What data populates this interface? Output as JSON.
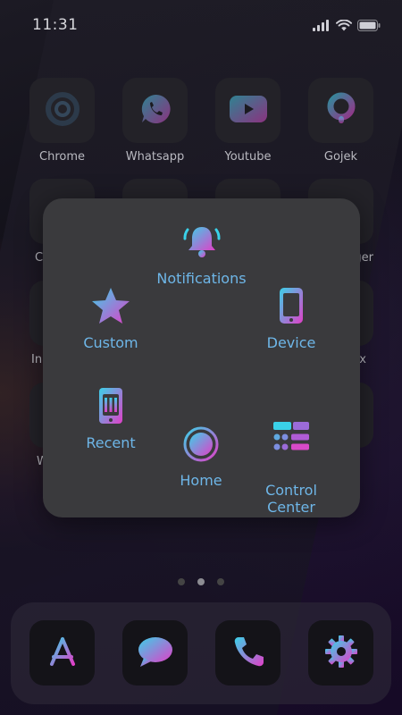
{
  "status_bar": {
    "time": "11:31"
  },
  "home_apps_row1": [
    {
      "label": "Chrome",
      "icon": "chrome-icon"
    },
    {
      "label": "Whatsapp",
      "icon": "whatsapp-icon"
    },
    {
      "label": "Youtube",
      "icon": "youtube-icon"
    },
    {
      "label": "Gojek",
      "icon": "gojek-icon"
    }
  ],
  "partial_labels": {
    "row2_left": "C",
    "row2_right": "ger",
    "row3_left": "In",
    "row3_right": "x",
    "row4_left": "W"
  },
  "assistive_menu": {
    "items": [
      {
        "label": "Notifications",
        "icon": "bell-icon"
      },
      {
        "label": "Custom",
        "icon": "star-icon"
      },
      {
        "label": "Device",
        "icon": "device-icon"
      },
      {
        "label": "Recent",
        "icon": "recent-apps-icon"
      },
      {
        "label": "Control\nCenter",
        "icon": "control-center-icon"
      },
      {
        "label": "Home",
        "icon": "home-button-icon"
      }
    ]
  },
  "page_dots": {
    "count": 3,
    "active_index": 1
  },
  "dock": [
    {
      "icon": "app-store-icon"
    },
    {
      "icon": "messages-icon"
    },
    {
      "icon": "phone-icon"
    },
    {
      "icon": "settings-icon"
    }
  ],
  "colors": {
    "accent_text": "#6eb6e8",
    "gradient_start": "#3ad1e8",
    "gradient_end": "#e040c8",
    "panel_bg": "#3a3a3d"
  }
}
